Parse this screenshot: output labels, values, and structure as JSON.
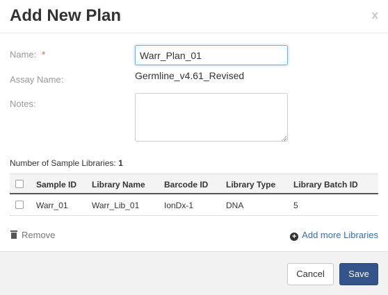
{
  "dialog": {
    "title": "Add New Plan",
    "close_label": "x"
  },
  "form": {
    "name_label": "Name:",
    "required_mark": "*",
    "name_value": "Warr_Plan_01",
    "assay_label": "Assay Name:",
    "assay_value": "Germline_v4.61_Revised",
    "notes_label": "Notes:",
    "notes_value": ""
  },
  "samples": {
    "count_label": "Number of Sample Libraries:",
    "count": "1",
    "columns": [
      "Sample ID",
      "Library Name",
      "Barcode ID",
      "Library Type",
      "Library Batch ID"
    ],
    "rows": [
      {
        "checked": false,
        "cells": [
          "Warr_01",
          "Warr_Lib_01",
          "IonDx-1",
          "DNA",
          "5"
        ]
      }
    ]
  },
  "actions": {
    "remove_label": "Remove",
    "add_more_label": "Add more Libraries"
  },
  "footer": {
    "cancel_label": "Cancel",
    "save_label": "Save"
  },
  "colors": {
    "primary": "#34538a",
    "link": "#3a6ea5",
    "required": "#e5534b",
    "focus": "#66afe9"
  }
}
